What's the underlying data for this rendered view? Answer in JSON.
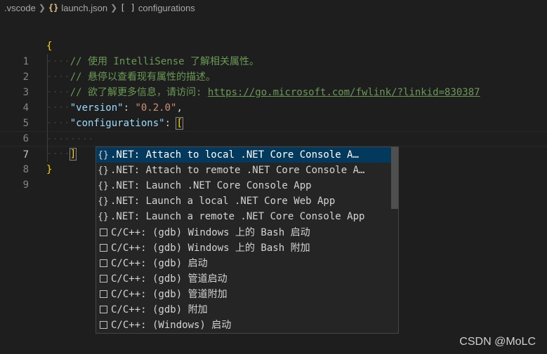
{
  "breadcrumb": {
    "folder": ".vscode",
    "file_icon": "{}",
    "file": "launch.json",
    "node_icon": "[ ]",
    "node": "configurations"
  },
  "editor": {
    "lines": [
      {
        "n": "1"
      },
      {
        "n": "2"
      },
      {
        "n": "3"
      },
      {
        "n": "4"
      },
      {
        "n": "5"
      },
      {
        "n": "6"
      },
      {
        "n": "7"
      },
      {
        "n": "8"
      },
      {
        "n": "9"
      }
    ],
    "open_brace": "{",
    "comment1": "// 使用 IntelliSense 了解相关属性。",
    "comment2": "// 悬停以查看现有属性的描述。",
    "comment3_prefix": "// 欲了解更多信息，请访问: ",
    "comment3_link": "https://go.microsoft.com/fwlink/?linkid=830387",
    "version_key": "\"version\"",
    "version_value": "\"0.2.0\"",
    "configurations_key": "\"configurations\"",
    "open_bracket": "[",
    "close_bracket": "]",
    "close_brace": "}"
  },
  "suggestions": [
    {
      "icon": "{}",
      "label": ".NET: Attach to local .NET Core Console A…",
      "selected": true
    },
    {
      "icon": "{}",
      "label": ".NET: Attach to remote .NET Core Console A…"
    },
    {
      "icon": "{}",
      "label": ".NET: Launch .NET Core Console App"
    },
    {
      "icon": "{}",
      "label": ".NET: Launch a local .NET Core Web App"
    },
    {
      "icon": "{}",
      "label": ".NET: Launch a remote .NET Core Console App"
    },
    {
      "icon": "box",
      "label": "C/C++: (gdb) Windows 上的 Bash 启动"
    },
    {
      "icon": "box",
      "label": "C/C++: (gdb) Windows 上的 Bash 附加"
    },
    {
      "icon": "box",
      "label": "C/C++: (gdb) 启动"
    },
    {
      "icon": "box",
      "label": "C/C++: (gdb) 管道启动"
    },
    {
      "icon": "box",
      "label": "C/C++: (gdb) 管道附加"
    },
    {
      "icon": "box",
      "label": "C/C++: (gdb) 附加"
    },
    {
      "icon": "box",
      "label": "C/C++: (Windows) 启动"
    }
  ],
  "watermark": "CSDN @MoLC",
  "colors": {
    "background": "#1e1e1e",
    "selection": "#04395e",
    "comment": "#6a9955",
    "key": "#9cdcfe",
    "string": "#ce9178"
  }
}
